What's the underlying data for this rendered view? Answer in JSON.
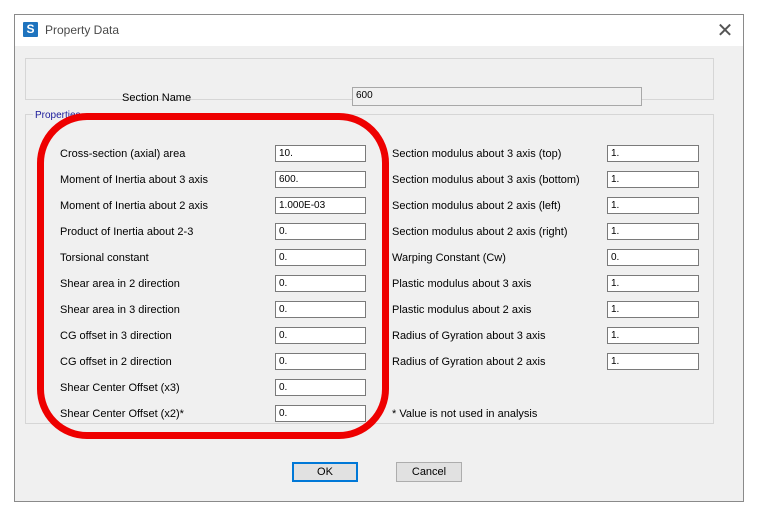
{
  "window": {
    "title": "Property Data",
    "app_icon_letter": "S",
    "close_symbol": "✕"
  },
  "section": {
    "label": "Section Name",
    "value": "600"
  },
  "properties": {
    "group_title": "Properties",
    "left": [
      {
        "label": "Cross-section (axial) area",
        "value": "10."
      },
      {
        "label": "Moment of Inertia about 3 axis",
        "value": "600."
      },
      {
        "label": "Moment of Inertia about 2 axis",
        "value": "1.000E-03"
      },
      {
        "label": "Product of Inertia about 2-3",
        "value": "0."
      },
      {
        "label": "Torsional constant",
        "value": "0."
      },
      {
        "label": "Shear area in 2 direction",
        "value": "0."
      },
      {
        "label": "Shear area in 3 direction",
        "value": "0."
      },
      {
        "label": "CG offset in 3 direction",
        "value": "0."
      },
      {
        "label": "CG offset in 2 direction",
        "value": "0."
      },
      {
        "label": "Shear Center Offset (x3)",
        "value": "0."
      },
      {
        "label": "Shear Center Offset (x2)*",
        "value": "0."
      }
    ],
    "right": [
      {
        "label": "Section modulus about 3 axis (top)",
        "value": "1."
      },
      {
        "label": "Section modulus about 3 axis (bottom)",
        "value": "1."
      },
      {
        "label": "Section modulus about 2 axis (left)",
        "value": "1."
      },
      {
        "label": "Section modulus about 2 axis (right)",
        "value": "1."
      },
      {
        "label": "Warping Constant (Cw)",
        "value": "0."
      },
      {
        "label": "Plastic modulus about 3 axis",
        "value": "1."
      },
      {
        "label": "Plastic modulus about 2 axis",
        "value": "1."
      },
      {
        "label": "Radius of Gyration about 3 axis",
        "value": "1."
      },
      {
        "label": "Radius of Gyration about 2 axis",
        "value": "1."
      }
    ],
    "note": "*  Value is not used in analysis"
  },
  "buttons": {
    "ok": "OK",
    "cancel": "Cancel"
  },
  "colors": {
    "highlight": "#ee0000",
    "accent": "#0078d7",
    "app_icon": "#1e73be"
  }
}
